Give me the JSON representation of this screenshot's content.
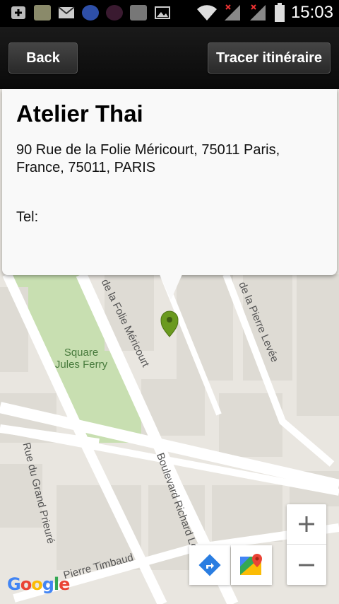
{
  "status_bar": {
    "time": "15:03",
    "icons": [
      "add-icon",
      "gallery-thumb-icon",
      "mail-icon",
      "app-notification-icon",
      "app-notification-icon-2",
      "app-notification-icon-3",
      "image-icon",
      "wifi-icon",
      "signal-no-service-icon",
      "signal-no-service-icon-2",
      "battery-icon"
    ]
  },
  "action_bar": {
    "back_label": "Back",
    "route_label": "Tracer itinéraire"
  },
  "info_window": {
    "name": "Atelier Thai",
    "address": "90 Rue de la Folie Méricourt, 75011 Paris, France, 75011, PARIS",
    "tel_label": "Tel:"
  },
  "map": {
    "streets": {
      "folie_mericourt": "de la Folie Méricourt",
      "pierre_levee": "de la Pierre Levée",
      "grand_prieure": "Rue du Grand Prieuré",
      "richard_lenoir": "Boulevard Richard Lenoir",
      "pierre_timbaud": "Pierre Timbaud"
    },
    "park_name": "Square Jules Ferry",
    "park_line1": "Square",
    "park_line2": "Jules Ferry",
    "marker_color": "#6a9a1f",
    "park_color": "#c8dfb1"
  },
  "controls": {
    "zoom_in": "+",
    "zoom_out": "−",
    "directions_icon": "directions-icon",
    "maps_icon": "google-maps-icon"
  },
  "attribution": "Google"
}
